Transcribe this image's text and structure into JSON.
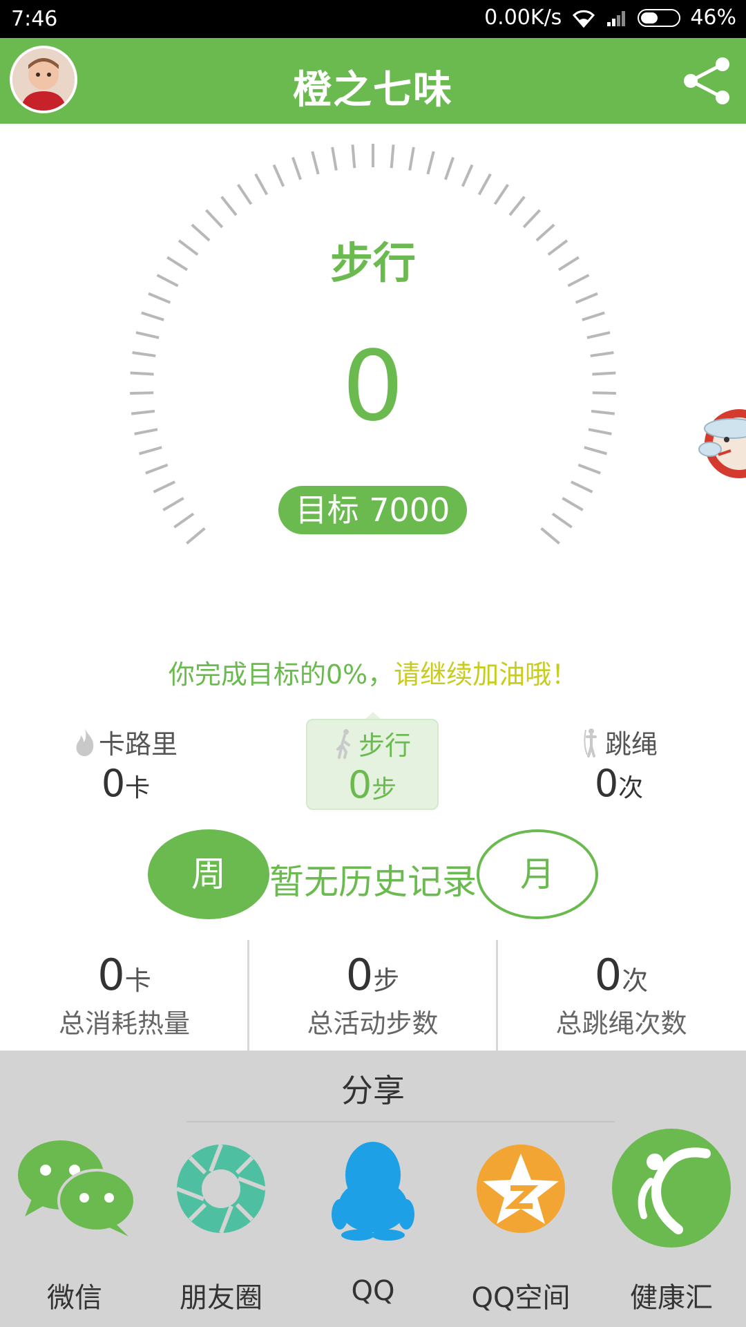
{
  "status_bar": {
    "time": "7:46",
    "speed": "0.00K/s",
    "battery": "46%",
    "battery_level": 0.46
  },
  "header": {
    "title": "橙之七味"
  },
  "dial": {
    "label": "步行",
    "value": "0",
    "target": "目标 7000"
  },
  "progress": {
    "part1": "你完成目标的0%，",
    "part2": "请继续加油哦！"
  },
  "tabs": [
    {
      "label": "卡路里",
      "value": "0",
      "unit": "卡",
      "icon": "flame-icon",
      "active": false
    },
    {
      "label": "步行",
      "value": "0",
      "unit": "步",
      "icon": "walker-icon",
      "active": true
    },
    {
      "label": "跳绳",
      "value": "0",
      "unit": "次",
      "icon": "jump-rope-icon",
      "active": false
    }
  ],
  "history": {
    "week": "周",
    "message": "暂无历史记录",
    "month": "月"
  },
  "totals": [
    {
      "value": "0",
      "unit": "卡",
      "label": "总消耗热量"
    },
    {
      "value": "0",
      "unit": "步",
      "label": "总活动步数"
    },
    {
      "value": "0",
      "unit": "次",
      "label": "总跳绳次数"
    }
  ],
  "share": {
    "title": "分享",
    "items": [
      {
        "label": "微信",
        "icon": "wechat-icon",
        "color": "#6aba4f"
      },
      {
        "label": "朋友圈",
        "icon": "moments-icon",
        "color": "#4fbfa1"
      },
      {
        "label": "QQ",
        "icon": "qq-icon",
        "color": "#1ea0e6"
      },
      {
        "label": "QQ空间",
        "icon": "qzone-icon",
        "color": "#f2a533"
      },
      {
        "label": "健康汇",
        "icon": "health-hub-icon",
        "color": "#6aba4f"
      }
    ]
  },
  "colors": {
    "accent": "#6aba4f",
    "light_accent": "#e4f2df",
    "encourage": "#c8cc1e"
  }
}
